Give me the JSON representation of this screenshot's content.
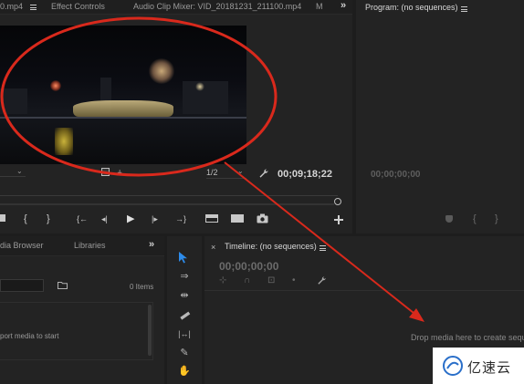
{
  "source": {
    "tabs": [
      {
        "label": "0.mp4"
      },
      {
        "label": "Effect Controls"
      },
      {
        "label": "Audio Clip Mixer: VID_20181231_211100.mp4"
      },
      {
        "label": "M"
      }
    ],
    "overflow_glyph": "»",
    "fit_select": "",
    "resolution_select": "1/2",
    "timecode": "00;09;18;22",
    "transport": {
      "mark_in": "{",
      "mark_out": "}",
      "goto_in": "{←",
      "step_back": "◂|",
      "play": "▶",
      "step_forward": "|▸",
      "goto_out": "→}"
    }
  },
  "program": {
    "title": "Program: (no sequences)",
    "timecode": "00;00;00;00",
    "mark_in": "{",
    "mark_out": "}"
  },
  "project": {
    "tabs": [
      {
        "label": "dia Browser"
      },
      {
        "label": "Libraries"
      }
    ],
    "overflow_glyph": "»",
    "item_count": "0 Items",
    "import_hint": "port media to start"
  },
  "timeline": {
    "title": "Timeline: (no sequences)",
    "timecode": "00;00;00;00",
    "drop_hint": "Drop media here to create sequ"
  },
  "watermark": {
    "text": "亿速云"
  },
  "colors": {
    "accent_blue": "#2d8ceb",
    "annotation_red": "#d9291c",
    "panel_bg": "#232323",
    "app_bg": "#1d1d1d"
  },
  "icons": {
    "wrench": "wrench-icon",
    "camera": "camera-icon",
    "add": "plus-icon",
    "selection": "selection-arrow-icon"
  }
}
